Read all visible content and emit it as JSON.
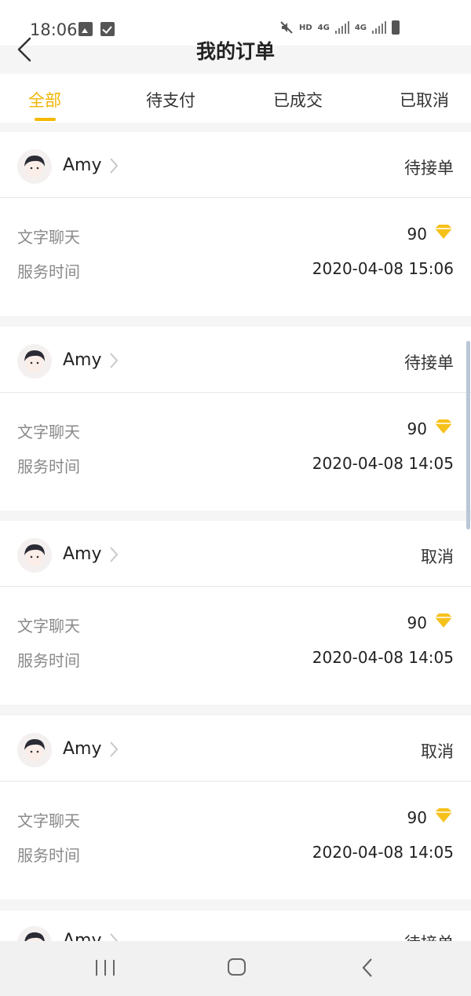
{
  "status_bar": {
    "time": "18:06",
    "left_icons": [
      "image-icon",
      "checkbox-icon"
    ],
    "right_icons": [
      "mute-icon",
      "hd-icon",
      "signal-4g-icon",
      "signal-4g-icon",
      "battery-icon"
    ],
    "hd": "HD",
    "net1": "4G",
    "net2": "4G"
  },
  "header": {
    "title": "我的订单",
    "back_icon": "back-arrow-icon"
  },
  "tabs": [
    {
      "label": "全部",
      "active": true
    },
    {
      "label": "待支付",
      "active": false
    },
    {
      "label": "已成交",
      "active": false
    },
    {
      "label": "已取消",
      "active": false
    }
  ],
  "orders": [
    {
      "user": "Amy",
      "status": "待接单",
      "service": "文字聊天",
      "price": "90",
      "time_label": "服务时间",
      "time": "2020-04-08 15:06"
    },
    {
      "user": "Amy",
      "status": "待接单",
      "service": "文字聊天",
      "price": "90",
      "time_label": "服务时间",
      "time": "2020-04-08 14:05"
    },
    {
      "user": "Amy",
      "status": "取消",
      "service": "文字聊天",
      "price": "90",
      "time_label": "服务时间",
      "time": "2020-04-08 14:05"
    },
    {
      "user": "Amy",
      "status": "取消",
      "service": "文字聊天",
      "price": "90",
      "time_label": "服务时间",
      "time": "2020-04-08 14:05"
    },
    {
      "user": "Amy",
      "status": "待接单",
      "service": "",
      "price": "",
      "time_label": "",
      "time": ""
    }
  ],
  "colors": {
    "accent": "#f5b800",
    "diamond": "#f7c11c",
    "background": "#f5f5f5"
  },
  "nav_bar": {
    "icons": [
      "recent-apps-icon",
      "home-icon",
      "back-icon"
    ]
  }
}
